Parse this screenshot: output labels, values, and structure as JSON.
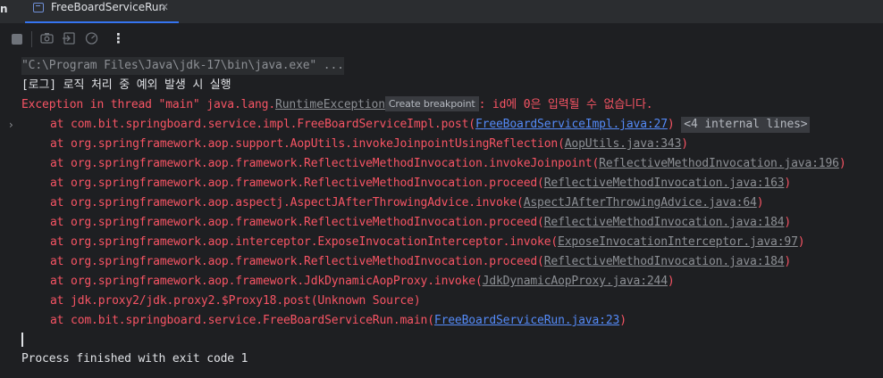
{
  "tabbar": {
    "left_cut_label": "n",
    "active_tab_label": "FreeBoardServiceRun",
    "close_glyph": "✕"
  },
  "toolbar": {
    "icons": [
      "stop-icon",
      "camera-icon",
      "restore-layout-icon",
      "dashboard-icon",
      "more-options-icon"
    ],
    "more_glyph": "⋮"
  },
  "console": {
    "command": "\"C:\\Program Files\\Java\\jdk-17\\bin\\java.exe\" ...",
    "log_line": "[로그] 로직 처리 중 예외 발생 시 실행",
    "exception": {
      "prefix": "Exception in thread \"main\" java.lang.",
      "class_link": "RuntimeException",
      "breakpoint_chip": "Create breakpoint",
      "message": ": id에 0은 입력될 수 없습니다."
    },
    "stack": [
      {
        "text": "at com.bit.springboard.service.impl.FreeBoardServiceImpl.post(",
        "link": "FreeBoardServiceImpl.java:27",
        "link_style": "blue",
        "suffix": ")",
        "badge": "<4 internal lines>"
      },
      {
        "text": "at org.springframework.aop.support.AopUtils.invokeJoinpointUsingReflection(",
        "link": "AopUtils.java:343",
        "link_style": "gray",
        "suffix": ")"
      },
      {
        "text": "at org.springframework.aop.framework.ReflectiveMethodInvocation.invokeJoinpoint(",
        "link": "ReflectiveMethodInvocation.java:196",
        "link_style": "gray",
        "suffix": ")"
      },
      {
        "text": "at org.springframework.aop.framework.ReflectiveMethodInvocation.proceed(",
        "link": "ReflectiveMethodInvocation.java:163",
        "link_style": "gray",
        "suffix": ")"
      },
      {
        "text": "at org.springframework.aop.aspectj.AspectJAfterThrowingAdvice.invoke(",
        "link": "AspectJAfterThrowingAdvice.java:64",
        "link_style": "gray",
        "suffix": ")"
      },
      {
        "text": "at org.springframework.aop.framework.ReflectiveMethodInvocation.proceed(",
        "link": "ReflectiveMethodInvocation.java:184",
        "link_style": "gray",
        "suffix": ")"
      },
      {
        "text": "at org.springframework.aop.interceptor.ExposeInvocationInterceptor.invoke(",
        "link": "ExposeInvocationInterceptor.java:97",
        "link_style": "gray",
        "suffix": ")"
      },
      {
        "text": "at org.springframework.aop.framework.ReflectiveMethodInvocation.proceed(",
        "link": "ReflectiveMethodInvocation.java:184",
        "link_style": "gray",
        "suffix": ")"
      },
      {
        "text": "at org.springframework.aop.framework.JdkDynamicAopProxy.invoke(",
        "link": "JdkDynamicAopProxy.java:244",
        "link_style": "gray",
        "suffix": ")"
      },
      {
        "text": "at jdk.proxy2/jdk.proxy2.$Proxy18.post(Unknown Source)",
        "link": "",
        "link_style": "none",
        "suffix": ""
      },
      {
        "text": "at com.bit.springboard.service.FreeBoardServiceRun.main(",
        "link": "FreeBoardServiceRun.java:23",
        "link_style": "blue",
        "suffix": ")"
      }
    ],
    "exit_line": "Process finished with exit code 1",
    "fold_glyph": "›"
  },
  "colors": {
    "background": "#1e1f22",
    "error_red": "#f75464",
    "link_blue": "#548af7",
    "tab_accent": "#3574f0"
  }
}
